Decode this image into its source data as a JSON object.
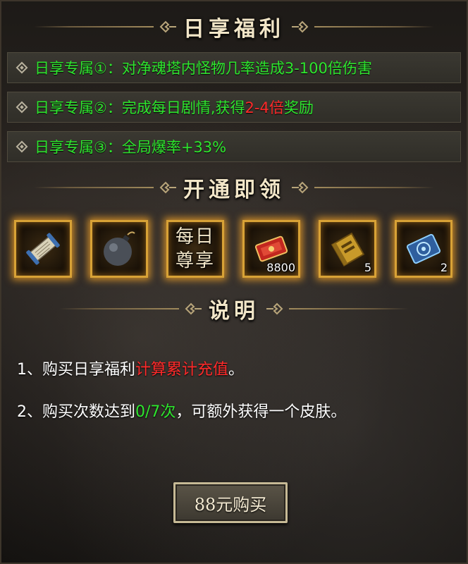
{
  "sections": {
    "benefits_title": "日享福利",
    "rewards_title": "开通即领",
    "notes_title": "说明"
  },
  "benefits": [
    {
      "prefix": "日享专属①：",
      "text": "对净魂塔内怪物几率造成3-100倍伤害"
    },
    {
      "prefix": "日享专属②：",
      "text_before": "完成每日剧情,获得",
      "highlight": "2-4倍",
      "text_after": "奖励"
    },
    {
      "prefix": "日享专属③：",
      "text": "全局爆率+33%"
    }
  ],
  "rewards": [
    {
      "icon": "scroll-icon",
      "count": ""
    },
    {
      "icon": "bomb-icon",
      "count": ""
    },
    {
      "icon": "daily-badge-icon",
      "label_line1": "每日",
      "label_line2": "尊享",
      "count": ""
    },
    {
      "icon": "red-ticket-icon",
      "count": "8800"
    },
    {
      "icon": "gold-book-icon",
      "count": "5"
    },
    {
      "icon": "blue-rune-scroll-icon",
      "count": "2"
    }
  ],
  "notes": {
    "line1_before": "1、购买日享福利",
    "line1_highlight": "计算累计充值",
    "line1_after": "。",
    "line2_before": "2、购买次数达到",
    "line2_progress": "0/7次",
    "line2_after": "，可额外获得一个皮肤。"
  },
  "buy_button": "88元购买",
  "colors": {
    "benefit_text": "#2ee62e",
    "highlight_red": "#ff2a2a",
    "frame_gold": "#d8a236",
    "title_text": "#f2e6c8"
  }
}
